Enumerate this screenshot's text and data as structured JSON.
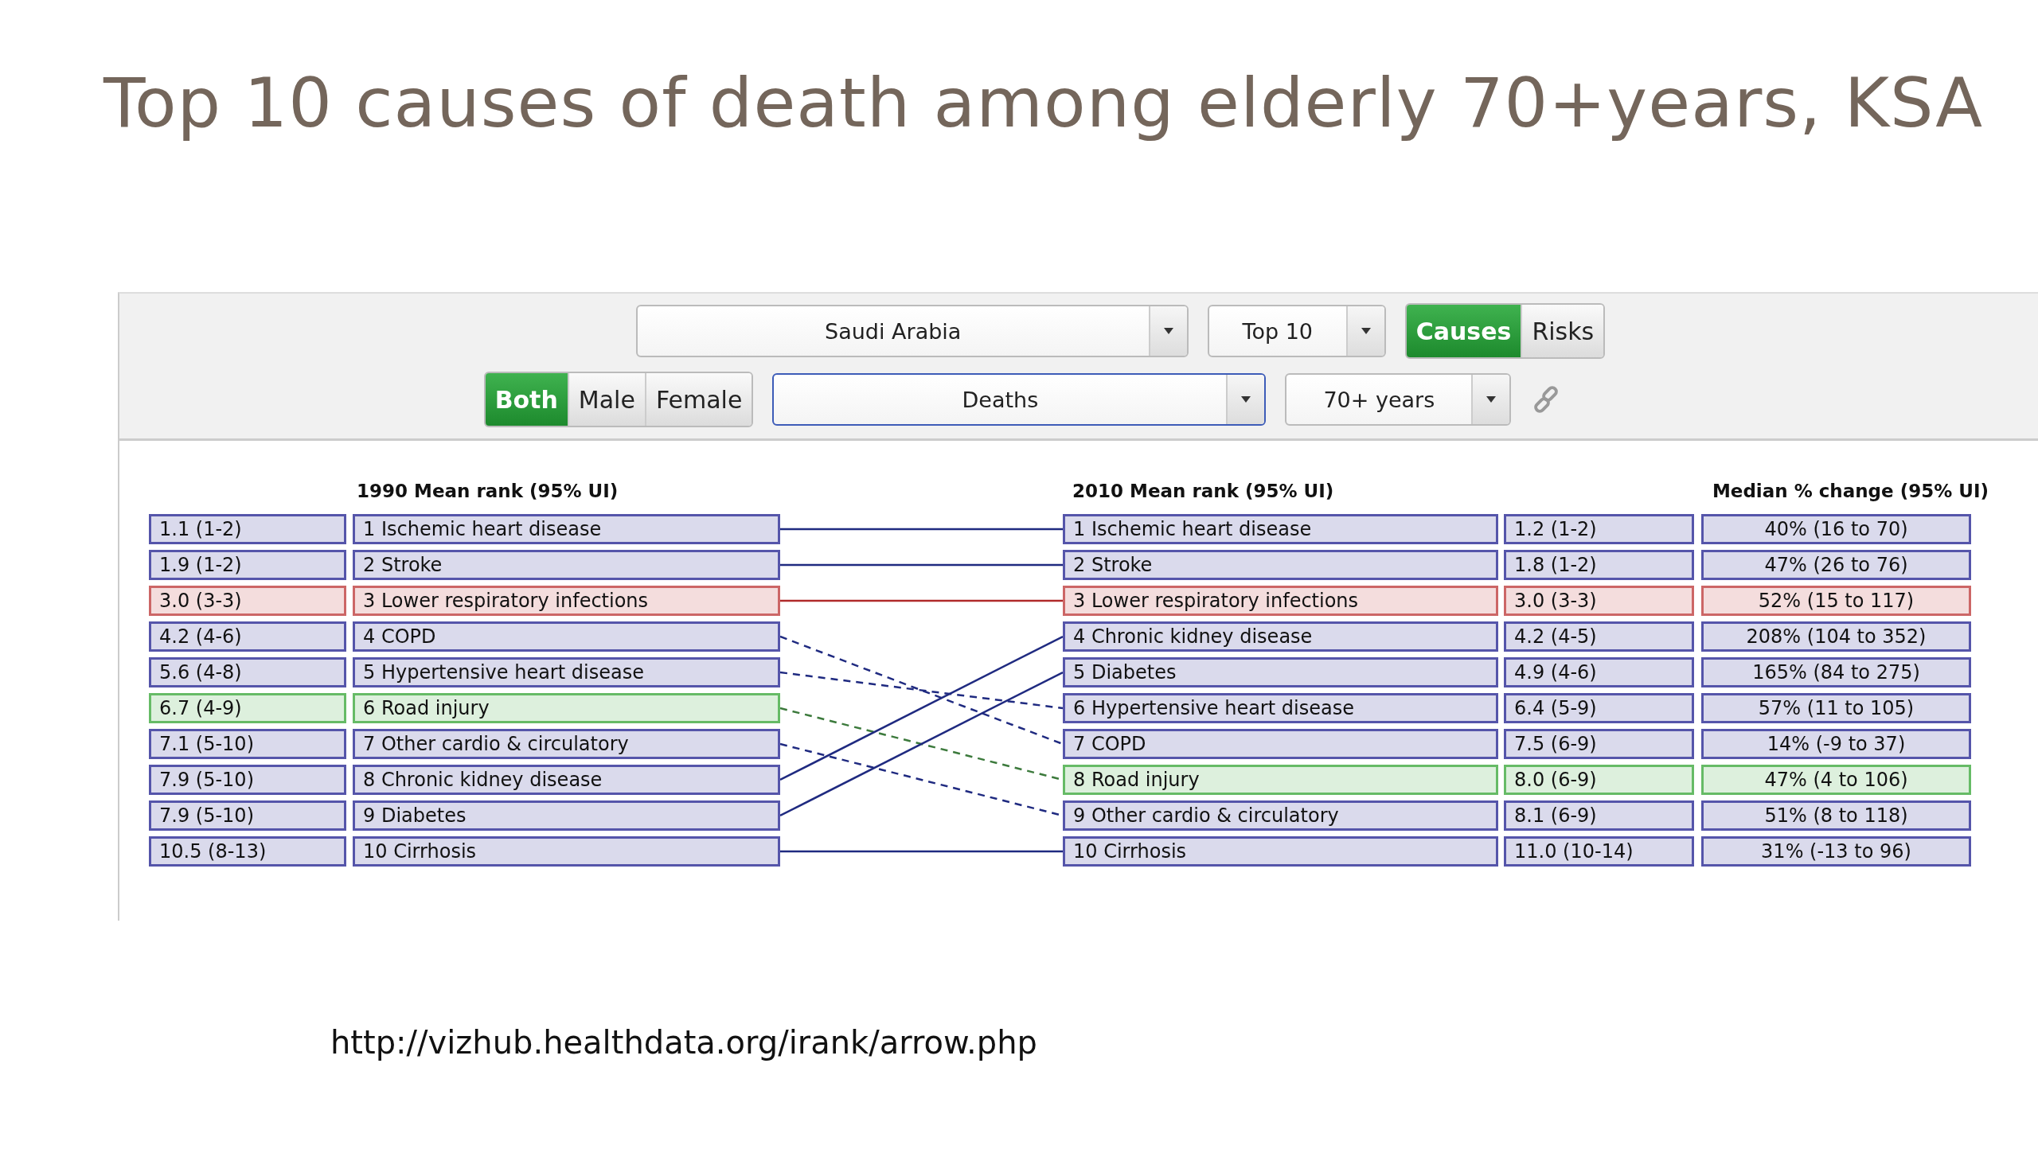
{
  "slide_title": "Top 10 causes of death among elderly 70+years, KSA",
  "controls": {
    "location": {
      "value": "Saudi Arabia"
    },
    "top": {
      "value": "Top 10"
    },
    "mode_toggle": [
      {
        "label": "Causes",
        "selected": true
      },
      {
        "label": "Risks",
        "selected": false
      }
    ],
    "sex_toggle": [
      {
        "label": "Both",
        "selected": true
      },
      {
        "label": "Male",
        "selected": false
      },
      {
        "label": "Female",
        "selected": false
      }
    ],
    "measure": {
      "value": "Deaths",
      "focused": true
    },
    "age": {
      "value": "70+ years"
    }
  },
  "table": {
    "headers": {
      "rank_1990": "1990 Mean rank (95% UI)",
      "rank_2010": "2010 Mean rank (95% UI)",
      "change": "Median % change (95% UI)"
    },
    "rows_1990": [
      {
        "value": "1.1 (1-2)",
        "label": "1 Ischemic heart disease",
        "color": "#5555aa"
      },
      {
        "value": "1.9 (1-2)",
        "label": "2 Stroke",
        "color": "#5555aa"
      },
      {
        "value": "3.0 (3-3)",
        "label": "3 Lower respiratory infections",
        "color": "#cc6666"
      },
      {
        "value": "4.2 (4-6)",
        "label": "4 COPD",
        "color": "#5555aa"
      },
      {
        "value": "5.6 (4-8)",
        "label": "5 Hypertensive heart disease",
        "color": "#5555aa"
      },
      {
        "value": "6.7 (4-9)",
        "label": "6 Road injury",
        "color": "#66bb66"
      },
      {
        "value": "7.1 (5-10)",
        "label": "7 Other cardio & circulatory",
        "color": "#5555aa"
      },
      {
        "value": "7.9 (5-10)",
        "label": "8 Chronic kidney disease",
        "color": "#5555aa"
      },
      {
        "value": "7.9 (5-10)",
        "label": "9 Diabetes",
        "color": "#5555aa"
      },
      {
        "value": "10.5 (8-13)",
        "label": "10 Cirrhosis",
        "color": "#5555aa"
      }
    ],
    "rows_2010": [
      {
        "label": "1 Ischemic heart disease",
        "value": "1.2 (1-2)",
        "change": "40% (16 to 70)",
        "color": "#5555aa"
      },
      {
        "label": "2 Stroke",
        "value": "1.8 (1-2)",
        "change": "47% (26 to 76)",
        "color": "#5555aa"
      },
      {
        "label": "3 Lower respiratory infections",
        "value": "3.0 (3-3)",
        "change": "52% (15 to 117)",
        "color": "#cc6666"
      },
      {
        "label": "4 Chronic kidney disease",
        "value": "4.2 (4-5)",
        "change": "208% (104 to 352)",
        "color": "#5555aa"
      },
      {
        "label": "5 Diabetes",
        "value": "4.9 (4-6)",
        "change": "165% (84 to 275)",
        "color": "#5555aa"
      },
      {
        "label": "6 Hypertensive heart disease",
        "value": "6.4 (5-9)",
        "change": "57% (11 to 105)",
        "color": "#5555aa"
      },
      {
        "label": "7 COPD",
        "value": "7.5 (6-9)",
        "change": "14% (-9 to 37)",
        "color": "#5555aa"
      },
      {
        "label": "8 Road injury",
        "value": "8.0 (6-9)",
        "change": "47% (4 to 106)",
        "color": "#66bb66"
      },
      {
        "label": "9 Other cardio & circulatory",
        "value": "8.1 (6-9)",
        "change": "51% (8 to 118)",
        "color": "#5555aa"
      },
      {
        "label": "10 Cirrhosis",
        "value": "11.0 (10-14)",
        "change": "31% (-13 to 96)",
        "color": "#5555aa"
      }
    ]
  },
  "source_url": "http://vizhub.healthdata.org/irank/arrow.php"
}
